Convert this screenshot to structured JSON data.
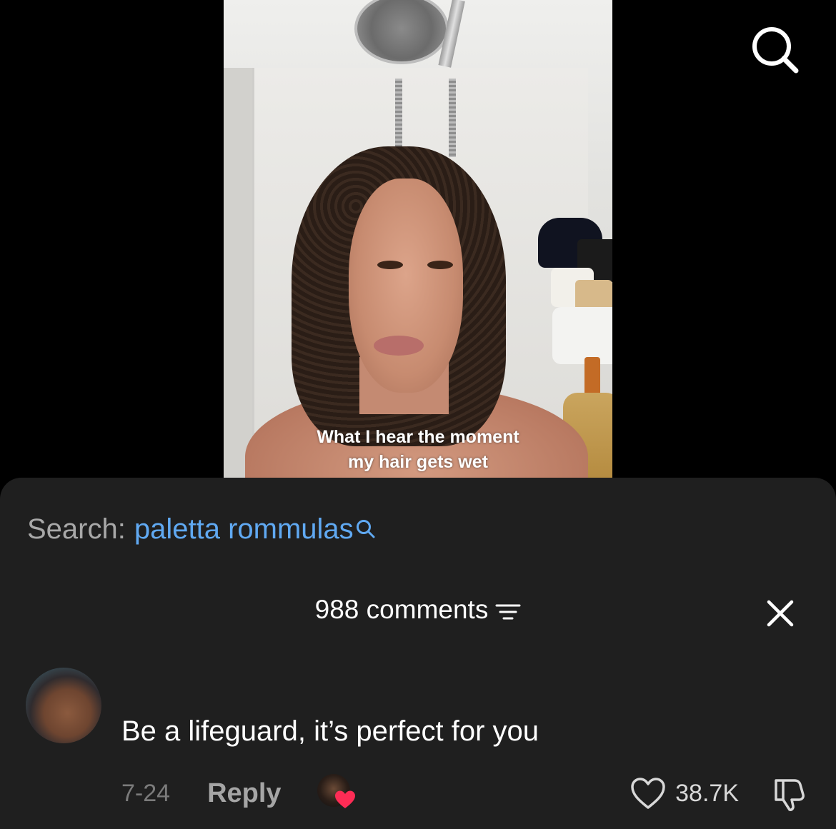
{
  "video": {
    "caption_line1": "What I hear the moment",
    "caption_line2": "my hair gets wet"
  },
  "top_bar": {
    "search_icon": "search-icon"
  },
  "comment_sheet": {
    "search_prefix": "Search:",
    "search_query": "paletta rommulas",
    "search_icon": "search-icon",
    "comments_count": "988 comments",
    "filter_icon": "filter-icon",
    "close_icon": "close-icon"
  },
  "comment": {
    "text": "Be a lifeguard, it’s perfect for you",
    "date": "7-24",
    "reply_label": "Reply",
    "likes": "38.7K",
    "like_icon": "heart-icon",
    "dislike_icon": "dislike-icon",
    "creator_liked_badge_color": "#fe2c55"
  },
  "colors": {
    "sheet_background": "#1f1f1f",
    "link_blue": "#60a9f2"
  }
}
